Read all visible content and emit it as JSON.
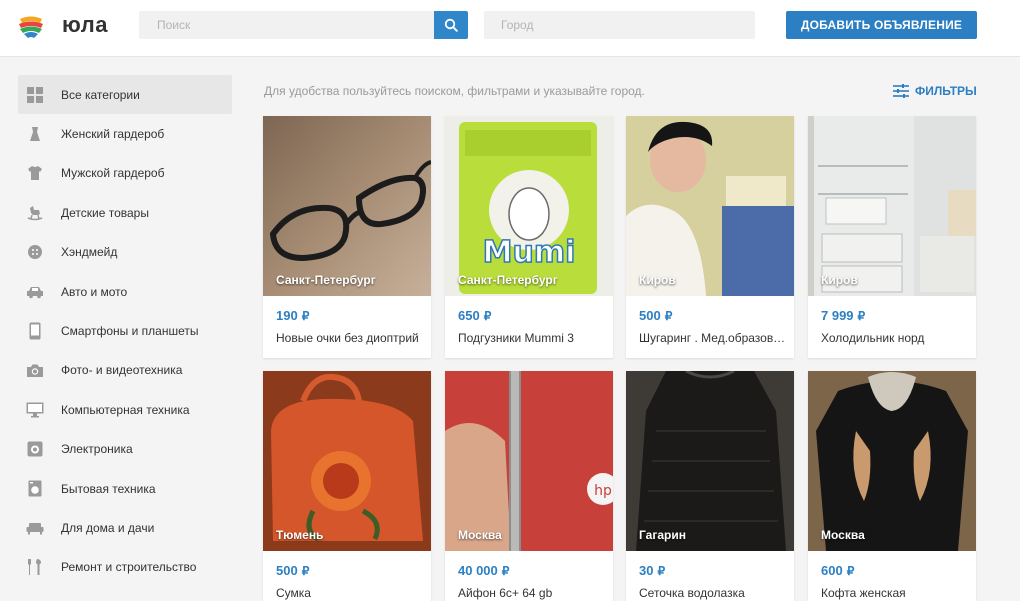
{
  "header": {
    "brand": "юла",
    "search_placeholder": "Поиск",
    "city_placeholder": "Город",
    "add_button": "ДОБАВИТЬ ОБЪЯВЛЕНИЕ",
    "accent_color": "#2c7fc2"
  },
  "sidebar": {
    "items": [
      {
        "label": "Все категории",
        "icon": "grid-icon",
        "active": true
      },
      {
        "label": "Женский гардероб",
        "icon": "dress-icon"
      },
      {
        "label": "Мужской гардероб",
        "icon": "shirt-icon"
      },
      {
        "label": "Детские товары",
        "icon": "rocking-horse-icon"
      },
      {
        "label": "Хэндмейд",
        "icon": "button-icon"
      },
      {
        "label": "Авто и мото",
        "icon": "car-icon"
      },
      {
        "label": "Смартфоны и планшеты",
        "icon": "phone-icon"
      },
      {
        "label": "Фото- и видеотехника",
        "icon": "camera-icon"
      },
      {
        "label": "Компьютерная техника",
        "icon": "monitor-icon"
      },
      {
        "label": "Электроника",
        "icon": "speaker-icon"
      },
      {
        "label": "Бытовая техника",
        "icon": "washing-machine-icon"
      },
      {
        "label": "Для дома и дачи",
        "icon": "sofa-icon"
      },
      {
        "label": "Ремонт и строительство",
        "icon": "tools-icon"
      }
    ]
  },
  "main": {
    "hint": "Для удобства пользуйтесь поиском, фильтрами и указывайте город.",
    "filters_label": "ФИЛЬТРЫ",
    "listings": [
      {
        "city": "Санкт-Петербург",
        "price": "190",
        "title": "Новые очки без диоптрий",
        "photo": "glasses-photo"
      },
      {
        "city": "Санкт-Петербург",
        "price": "650",
        "title": "Подгузники Mummi 3",
        "photo": "diapers-photo"
      },
      {
        "city": "Киров",
        "price": "500",
        "title": "Шугаринг . Мед.образование",
        "photo": "person-photo"
      },
      {
        "city": "Киров",
        "price": "7 999",
        "title": "Холодильник норд",
        "photo": "fridge-photo"
      },
      {
        "city": "Тюмень",
        "price": "500",
        "title": "Сумка",
        "photo": "bag-photo"
      },
      {
        "city": "Москва",
        "price": "40 000",
        "title": "Айфон 6с+ 64 gb",
        "photo": "phone-photo"
      },
      {
        "city": "Гагарин",
        "price": "30",
        "title": "Сеточка водолазка",
        "photo": "top-photo"
      },
      {
        "city": "Москва",
        "price": "600",
        "title": "Кофта женская",
        "photo": "sweater-photo"
      }
    ]
  }
}
